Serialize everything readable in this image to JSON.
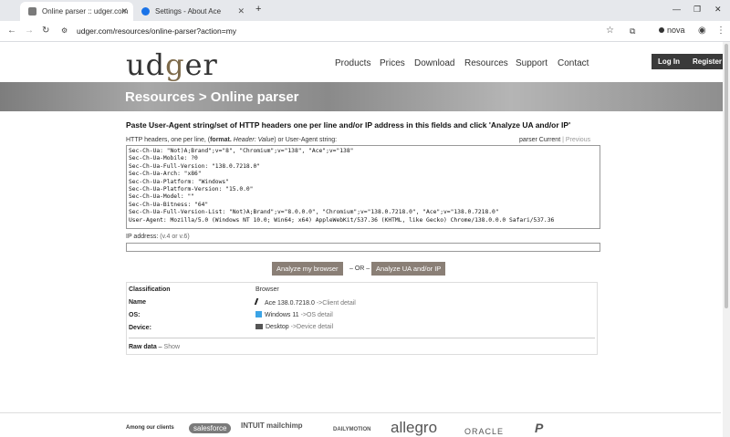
{
  "browser": {
    "tabs": [
      {
        "title": "Online parser :: udger.com",
        "active": true
      },
      {
        "title": "Settings - About Ace",
        "active": false
      }
    ],
    "new_tab": "+",
    "url": "udger.com/resources/online-parser?action=my",
    "profile": "nova",
    "window_controls": {
      "minimize": "—",
      "maximize": "❐",
      "close": "✕"
    }
  },
  "site": {
    "logo": {
      "prefix": "ud",
      "highlight": "g",
      "suffix": "er"
    },
    "nav": [
      "Products",
      "Prices",
      "Download",
      "Resources",
      "Support",
      "Contact"
    ],
    "login": "Log In",
    "register": "Register",
    "banner_title": "Resources > Online parser"
  },
  "parser": {
    "intro": "Paste User-Agent string/set of HTTP headers one per line and/or IP address in this fields and click 'Analyze UA and/or IP'",
    "ta_label_1": "HTTP headers, one per line, (",
    "ta_label_fmt": "format.",
    "ta_label_2": " Header: Value",
    "ta_label_3": ") or User-Agent string:",
    "parser_label": "parser",
    "parser_current": "Current",
    "parser_sep": " | ",
    "parser_previous": "Previous",
    "ua_text": "Sec-Ch-Ua: \"Not)A;Brand\";v=\"8\", \"Chromium\";v=\"138\", \"Ace\";v=\"138\"\nSec-Ch-Ua-Mobile: ?0\nSec-Ch-Ua-Full-Version: \"138.0.7218.0\"\nSec-Ch-Ua-Arch: \"x86\"\nSec-Ch-Ua-Platform: \"Windows\"\nSec-Ch-Ua-Platform-Version: \"15.0.0\"\nSec-Ch-Ua-Model: \"\"\nSec-Ch-Ua-Bitness: \"64\"\nSec-Ch-Ua-Full-Version-List: \"Not)A;Brand\";v=\"8.0.0.0\", \"Chromium\";v=\"138.0.7218.0\", \"Ace\";v=\"138.0.7218.0\"\nUser-Agent: Mozilla/5.0 (Windows NT 10.0; Win64; x64) AppleWebKit/537.36 (KHTML, like Gecko) Chrome/138.0.0.0 Safari/537.36",
    "ip_label": "IP address:",
    "ip_hint": "(v.4 or v.6)",
    "btn_browser": "Analyze my browser",
    "or_text": "– OR –",
    "btn_analyze": "Analyze UA and/or IP"
  },
  "results": {
    "classification_label": "Classification",
    "classification_value": "Browser",
    "name_label": "Name",
    "name_value": "Ace 138.0.7218.0",
    "name_link": "->Client detail",
    "os_label": "OS:",
    "os_value": "Windows 11",
    "os_link": "->OS detail",
    "device_label": "Device:",
    "device_value": "Desktop",
    "device_link": "->Device detail",
    "raw_label": "Raw data",
    "raw_sep": " – ",
    "raw_link": "Show"
  },
  "footer": {
    "clients_label": "Among our clients",
    "clients": [
      "salesforce",
      "INTUIT mailchimp",
      "DAILYMOTION",
      "allegro",
      "ORACLE",
      "P"
    ]
  }
}
